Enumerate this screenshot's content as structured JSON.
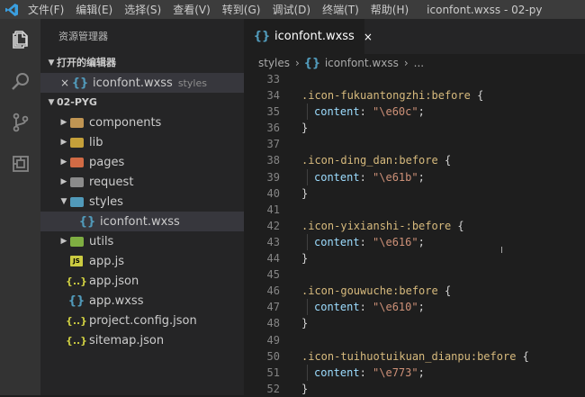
{
  "window": {
    "menu": [
      "文件(F)",
      "编辑(E)",
      "选择(S)",
      "查看(V)",
      "转到(G)",
      "调试(D)",
      "终端(T)",
      "帮助(H)"
    ],
    "title": "iconfont.wxss - 02-py"
  },
  "activity_bar": [
    "explorer-icon",
    "search-icon",
    "source-control-icon",
    "extensions-icon"
  ],
  "explorer": {
    "title": "资源管理器",
    "open_editors_label": "打开的编辑器",
    "open_editor": {
      "close": "×",
      "name": "iconfont.wxss",
      "hint": "styles"
    },
    "project_label": "02-PYG",
    "tree": [
      {
        "name": "components",
        "type": "folder",
        "color": "#c09553"
      },
      {
        "name": "lib",
        "type": "folder",
        "color": "#c5a03a"
      },
      {
        "name": "pages",
        "type": "folder",
        "color": "#d16b45"
      },
      {
        "name": "request",
        "type": "folder",
        "color": "#8b8b8b"
      },
      {
        "name": "styles",
        "type": "folder-open",
        "color": "#519aba"
      },
      {
        "name": "iconfont.wxss",
        "type": "css",
        "nested": true,
        "selected": true
      },
      {
        "name": "utils",
        "type": "folder",
        "color": "#7fae42"
      },
      {
        "name": "app.js",
        "type": "js"
      },
      {
        "name": "app.json",
        "type": "json"
      },
      {
        "name": "app.wxss",
        "type": "css"
      },
      {
        "name": "project.config.json",
        "type": "json"
      },
      {
        "name": "sitemap.json",
        "type": "json"
      }
    ]
  },
  "editor": {
    "tab": {
      "name": "iconfont.wxss",
      "close": "×"
    },
    "breadcrumb": {
      "folder": "styles",
      "sep": "›",
      "file": "iconfont.wxss",
      "more": "..."
    },
    "lines": [
      {
        "n": "33",
        "kind": "blank"
      },
      {
        "n": "34",
        "kind": "selector",
        "sel": ".icon-fukuantongzhi:before",
        "brace": " {"
      },
      {
        "n": "35",
        "kind": "decl",
        "prop": "content",
        "colon": ": ",
        "val": "\"\\e60c\"",
        "semi": ";"
      },
      {
        "n": "36",
        "kind": "close",
        "brace": "}"
      },
      {
        "n": "37",
        "kind": "blank"
      },
      {
        "n": "38",
        "kind": "selector",
        "sel": ".icon-ding_dan:before",
        "brace": " {"
      },
      {
        "n": "39",
        "kind": "decl",
        "prop": "content",
        "colon": ": ",
        "val": "\"\\e61b\"",
        "semi": ";"
      },
      {
        "n": "40",
        "kind": "close",
        "brace": "}"
      },
      {
        "n": "41",
        "kind": "blank"
      },
      {
        "n": "42",
        "kind": "selector",
        "sel": ".icon-yixianshi-:before",
        "brace": " {"
      },
      {
        "n": "43",
        "kind": "decl",
        "prop": "content",
        "colon": ": ",
        "val": "\"\\e616\"",
        "semi": ";"
      },
      {
        "n": "44",
        "kind": "close",
        "brace": "}"
      },
      {
        "n": "45",
        "kind": "blank"
      },
      {
        "n": "46",
        "kind": "selector",
        "sel": ".icon-gouwuche:before",
        "brace": " {"
      },
      {
        "n": "47",
        "kind": "decl",
        "prop": "content",
        "colon": ": ",
        "val": "\"\\e610\"",
        "semi": ";"
      },
      {
        "n": "48",
        "kind": "close",
        "brace": "}"
      },
      {
        "n": "49",
        "kind": "blank"
      },
      {
        "n": "50",
        "kind": "selector",
        "sel": ".icon-tuihuotuikuan_dianpu:before",
        "brace": " {"
      },
      {
        "n": "51",
        "kind": "decl",
        "prop": "content",
        "colon": ": ",
        "val": "\"\\e773\"",
        "semi": ";"
      },
      {
        "n": "52",
        "kind": "close",
        "brace": "}"
      }
    ]
  }
}
